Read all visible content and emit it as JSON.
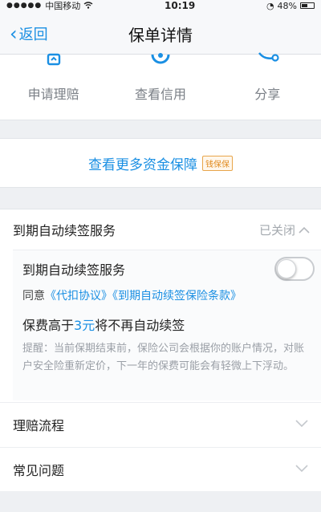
{
  "status_bar": {
    "carrier": "中国移动",
    "time": "10:19",
    "battery": "48%",
    "battery_level": 0.48
  },
  "nav": {
    "back_label": "返回",
    "title": "保单详情"
  },
  "actions": [
    {
      "label": "申请理赔",
      "icon": "claim-icon"
    },
    {
      "label": "查看信用",
      "icon": "credit-icon"
    },
    {
      "label": "分享",
      "icon": "share-icon"
    }
  ],
  "more": {
    "text": "查看更多资金保障",
    "badge": "钱保保"
  },
  "auto_renew": {
    "title": "到期自动续签服务",
    "status": "已关闭",
    "toggle_label": "到期自动续签服务",
    "toggle_on": false,
    "agree_prefix": "同意",
    "link1": "《代扣协议》",
    "link2": "《到期自动续签保险条款》",
    "fee_prefix": "保费高于",
    "fee_amount": "3元",
    "fee_suffix": "将不再自动续签",
    "tip": "提醒：当前保期结束前，保险公司会根据你的账户情况，对账户安全险重新定价，下一年的保费可能会有轻微上下浮动。"
  },
  "list": {
    "claim_flow": "理赔流程",
    "faq": "常见问题"
  },
  "colors": {
    "accent": "#1a8fe3",
    "badge": "#e08a1e"
  }
}
